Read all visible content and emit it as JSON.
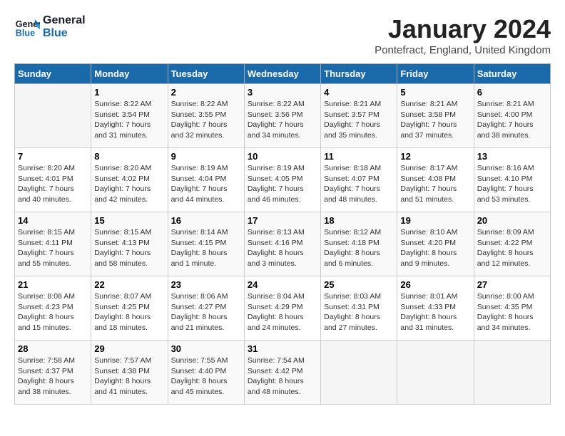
{
  "header": {
    "logo_line1": "General",
    "logo_line2": "Blue",
    "title": "January 2024",
    "location": "Pontefract, England, United Kingdom"
  },
  "weekdays": [
    "Sunday",
    "Monday",
    "Tuesday",
    "Wednesday",
    "Thursday",
    "Friday",
    "Saturday"
  ],
  "weeks": [
    [
      {
        "day": "",
        "info": ""
      },
      {
        "day": "1",
        "info": "Sunrise: 8:22 AM\nSunset: 3:54 PM\nDaylight: 7 hours\nand 31 minutes."
      },
      {
        "day": "2",
        "info": "Sunrise: 8:22 AM\nSunset: 3:55 PM\nDaylight: 7 hours\nand 32 minutes."
      },
      {
        "day": "3",
        "info": "Sunrise: 8:22 AM\nSunset: 3:56 PM\nDaylight: 7 hours\nand 34 minutes."
      },
      {
        "day": "4",
        "info": "Sunrise: 8:21 AM\nSunset: 3:57 PM\nDaylight: 7 hours\nand 35 minutes."
      },
      {
        "day": "5",
        "info": "Sunrise: 8:21 AM\nSunset: 3:58 PM\nDaylight: 7 hours\nand 37 minutes."
      },
      {
        "day": "6",
        "info": "Sunrise: 8:21 AM\nSunset: 4:00 PM\nDaylight: 7 hours\nand 38 minutes."
      }
    ],
    [
      {
        "day": "7",
        "info": "Sunrise: 8:20 AM\nSunset: 4:01 PM\nDaylight: 7 hours\nand 40 minutes."
      },
      {
        "day": "8",
        "info": "Sunrise: 8:20 AM\nSunset: 4:02 PM\nDaylight: 7 hours\nand 42 minutes."
      },
      {
        "day": "9",
        "info": "Sunrise: 8:19 AM\nSunset: 4:04 PM\nDaylight: 7 hours\nand 44 minutes."
      },
      {
        "day": "10",
        "info": "Sunrise: 8:19 AM\nSunset: 4:05 PM\nDaylight: 7 hours\nand 46 minutes."
      },
      {
        "day": "11",
        "info": "Sunrise: 8:18 AM\nSunset: 4:07 PM\nDaylight: 7 hours\nand 48 minutes."
      },
      {
        "day": "12",
        "info": "Sunrise: 8:17 AM\nSunset: 4:08 PM\nDaylight: 7 hours\nand 51 minutes."
      },
      {
        "day": "13",
        "info": "Sunrise: 8:16 AM\nSunset: 4:10 PM\nDaylight: 7 hours\nand 53 minutes."
      }
    ],
    [
      {
        "day": "14",
        "info": "Sunrise: 8:15 AM\nSunset: 4:11 PM\nDaylight: 7 hours\nand 55 minutes."
      },
      {
        "day": "15",
        "info": "Sunrise: 8:15 AM\nSunset: 4:13 PM\nDaylight: 7 hours\nand 58 minutes."
      },
      {
        "day": "16",
        "info": "Sunrise: 8:14 AM\nSunset: 4:15 PM\nDaylight: 8 hours\nand 1 minute."
      },
      {
        "day": "17",
        "info": "Sunrise: 8:13 AM\nSunset: 4:16 PM\nDaylight: 8 hours\nand 3 minutes."
      },
      {
        "day": "18",
        "info": "Sunrise: 8:12 AM\nSunset: 4:18 PM\nDaylight: 8 hours\nand 6 minutes."
      },
      {
        "day": "19",
        "info": "Sunrise: 8:10 AM\nSunset: 4:20 PM\nDaylight: 8 hours\nand 9 minutes."
      },
      {
        "day": "20",
        "info": "Sunrise: 8:09 AM\nSunset: 4:22 PM\nDaylight: 8 hours\nand 12 minutes."
      }
    ],
    [
      {
        "day": "21",
        "info": "Sunrise: 8:08 AM\nSunset: 4:23 PM\nDaylight: 8 hours\nand 15 minutes."
      },
      {
        "day": "22",
        "info": "Sunrise: 8:07 AM\nSunset: 4:25 PM\nDaylight: 8 hours\nand 18 minutes."
      },
      {
        "day": "23",
        "info": "Sunrise: 8:06 AM\nSunset: 4:27 PM\nDaylight: 8 hours\nand 21 minutes."
      },
      {
        "day": "24",
        "info": "Sunrise: 8:04 AM\nSunset: 4:29 PM\nDaylight: 8 hours\nand 24 minutes."
      },
      {
        "day": "25",
        "info": "Sunrise: 8:03 AM\nSunset: 4:31 PM\nDaylight: 8 hours\nand 27 minutes."
      },
      {
        "day": "26",
        "info": "Sunrise: 8:01 AM\nSunset: 4:33 PM\nDaylight: 8 hours\nand 31 minutes."
      },
      {
        "day": "27",
        "info": "Sunrise: 8:00 AM\nSunset: 4:35 PM\nDaylight: 8 hours\nand 34 minutes."
      }
    ],
    [
      {
        "day": "28",
        "info": "Sunrise: 7:58 AM\nSunset: 4:37 PM\nDaylight: 8 hours\nand 38 minutes."
      },
      {
        "day": "29",
        "info": "Sunrise: 7:57 AM\nSunset: 4:38 PM\nDaylight: 8 hours\nand 41 minutes."
      },
      {
        "day": "30",
        "info": "Sunrise: 7:55 AM\nSunset: 4:40 PM\nDaylight: 8 hours\nand 45 minutes."
      },
      {
        "day": "31",
        "info": "Sunrise: 7:54 AM\nSunset: 4:42 PM\nDaylight: 8 hours\nand 48 minutes."
      },
      {
        "day": "",
        "info": ""
      },
      {
        "day": "",
        "info": ""
      },
      {
        "day": "",
        "info": ""
      }
    ]
  ]
}
